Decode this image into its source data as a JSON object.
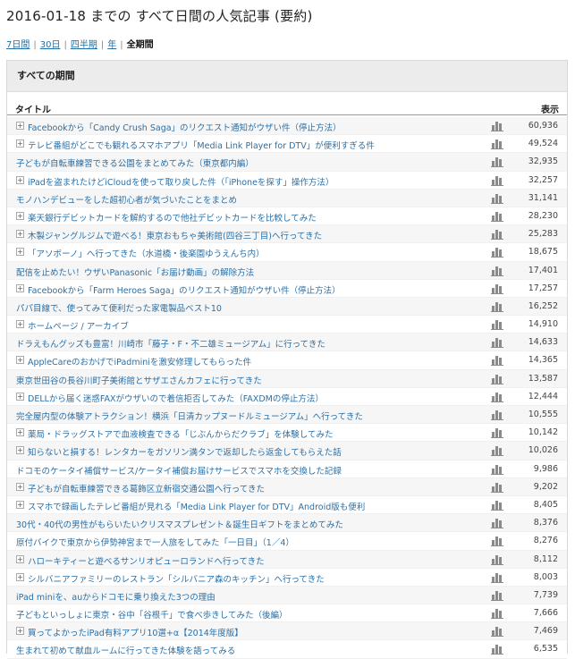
{
  "page": {
    "title": "2016-01-18 までの すべて日間の人気記事 (要約)"
  },
  "period_nav": {
    "items": [
      {
        "label": "7日間",
        "current": false
      },
      {
        "label": "30日",
        "current": false
      },
      {
        "label": "四半期",
        "current": false
      },
      {
        "label": "年",
        "current": false
      },
      {
        "label": "全期間",
        "current": true
      }
    ]
  },
  "panel": {
    "heading": "すべての期間",
    "col_title": "タイトル",
    "col_views": "表示"
  },
  "rows": [
    {
      "title": "Facebookから「Candy Crush Saga」のリクエスト通知がウザい件（停止方法）",
      "views": "60,936",
      "expand": true
    },
    {
      "title": "テレビ番組がどこでも観れるスマホアプリ「Media Link Player for DTV」が便利すぎる件",
      "views": "49,524",
      "expand": true
    },
    {
      "title": "子どもが自転車練習できる公園をまとめてみた（東京都内編）",
      "views": "32,935",
      "expand": false
    },
    {
      "title": "iPadを盗まれたけどiCloudを使って取り戻した件（「iPhoneを探す」操作方法）",
      "views": "32,257",
      "expand": true
    },
    {
      "title": "モノハンデビューをした超初心者が気づいたことをまとめ",
      "views": "31,141",
      "expand": false
    },
    {
      "title": "楽天銀行デビットカードを解約するので他社デビットカードを比較してみた",
      "views": "28,230",
      "expand": true
    },
    {
      "title": "木製ジャングルジムで遊べる！東京おもちゃ美術館(四谷三丁目)へ行ってきた",
      "views": "25,283",
      "expand": true
    },
    {
      "title": "「アソボーノ」へ行ってきた（水道橋・後楽園ゆうえんち内）",
      "views": "18,675",
      "expand": true
    },
    {
      "title": "配信を止めたい！ウザいPanasonic「お届け動画」の解除方法",
      "views": "17,401",
      "expand": false
    },
    {
      "title": "Facebookから「Farm Heroes Saga」のリクエスト通知がウザい件（停止方法）",
      "views": "17,257",
      "expand": true
    },
    {
      "title": "パパ目線で、使ってみて便利だった家電製品ベスト10",
      "views": "16,252",
      "expand": false
    },
    {
      "title": "ホームページ / アーカイブ",
      "views": "14,910",
      "expand": true
    },
    {
      "title": "ドラえもんグッズも豊富！川崎市「藤子・F・不二雄ミュージアム」に行ってきた",
      "views": "14,633",
      "expand": false
    },
    {
      "title": "AppleCareのおかげでiPadminiを激安修理してもらった件",
      "views": "14,365",
      "expand": true
    },
    {
      "title": "東京世田谷の長谷川町子美術館とサザエさんカフェに行ってきた",
      "views": "13,587",
      "expand": false
    },
    {
      "title": "DELLから届く迷惑FAXがウザいので着信拒否してみた（FAXDMの停止方法）",
      "views": "12,444",
      "expand": true
    },
    {
      "title": "完全屋内型の体験アトラクション！横浜「日清カップヌードルミュージアム」へ行ってきた",
      "views": "10,555",
      "expand": false
    },
    {
      "title": "薬局・ドラッグストアで血液検査できる「じぶんからだクラブ」を体験してみた",
      "views": "10,142",
      "expand": true
    },
    {
      "title": "知らないと損する！レンタカーをガソリン満タンで返却したら返金してもらえた話",
      "views": "10,026",
      "expand": true
    },
    {
      "title": "ドコモのケータイ補償サービス/ケータイ補償お届けサービスでスマホを交換した記録",
      "views": "9,986",
      "expand": false
    },
    {
      "title": "子どもが自転車練習できる葛飾区立新宿交通公園へ行ってきた",
      "views": "9,202",
      "expand": true
    },
    {
      "title": "スマホで録画したテレビ番組が見れる「Media Link Player for DTV」Android版も便利",
      "views": "8,405",
      "expand": true
    },
    {
      "title": "30代・40代の男性がもらいたいクリスマスプレゼント＆誕生日ギフトをまとめてみた",
      "views": "8,376",
      "expand": false
    },
    {
      "title": "原付バイクで東京から伊勢神宮まで一人旅をしてみた「一日目」（1／4）",
      "views": "8,276",
      "expand": false
    },
    {
      "title": "ハローキティーと遊べるサンリオピューロランドへ行ってきた",
      "views": "8,112",
      "expand": true
    },
    {
      "title": "シルバニアファミリーのレストラン「シルバニア森のキッチン」へ行ってきた",
      "views": "8,003",
      "expand": true
    },
    {
      "title": "iPad miniを、auからドコモに乗り換えた3つの理由",
      "views": "7,739",
      "expand": false
    },
    {
      "title": "子どもといっしょに東京・谷中「谷根千」で食べ歩きしてみた（後編）",
      "views": "7,666",
      "expand": false
    },
    {
      "title": "買ってよかったiPad有料アプリ10選+α【2014年度版】",
      "views": "7,469",
      "expand": true
    },
    {
      "title": "生まれて初めて献血ルームに行ってきた体験を語ってみる",
      "views": "6,535",
      "expand": false
    }
  ],
  "colors": {
    "link": "#2a6fa6",
    "header_bg": "#ececec",
    "row_alt": "#f6f6f6",
    "chart_icon": "#8a8a8a"
  },
  "icons": {
    "expand": "plus-box-icon",
    "stats": "bar-chart-icon"
  }
}
